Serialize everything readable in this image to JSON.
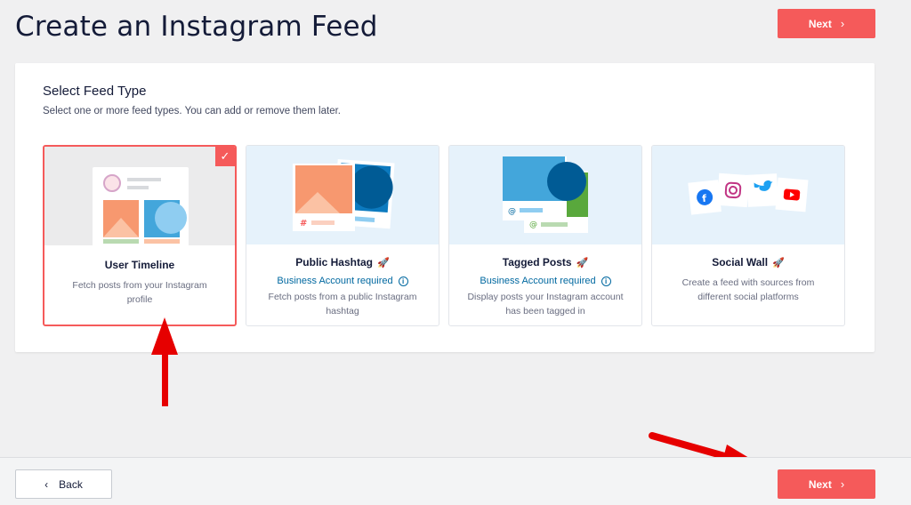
{
  "header": {
    "title": "Create an Instagram Feed",
    "next_label": "Next"
  },
  "section": {
    "title": "Select Feed Type",
    "subtitle": "Select one or more feed types. You can add or remove them later."
  },
  "feed_types": [
    {
      "name": "User Timeline",
      "description": "Fetch posts from your Instagram profile",
      "selected": true
    },
    {
      "name": "Public Hashtag",
      "business_note": "Business Account required",
      "description": "Fetch posts from a public Instagram hashtag"
    },
    {
      "name": "Tagged Posts",
      "business_note": "Business Account required",
      "description": "Display posts your Instagram account has been tagged in"
    },
    {
      "name": "Social Wall",
      "description": "Create a feed with sources from different social platforms"
    }
  ],
  "footer": {
    "back_label": "Back",
    "next_label": "Next"
  },
  "colors": {
    "accent": "#f55a5a",
    "link": "#0068a0",
    "annotation_arrow": "#e60000"
  }
}
